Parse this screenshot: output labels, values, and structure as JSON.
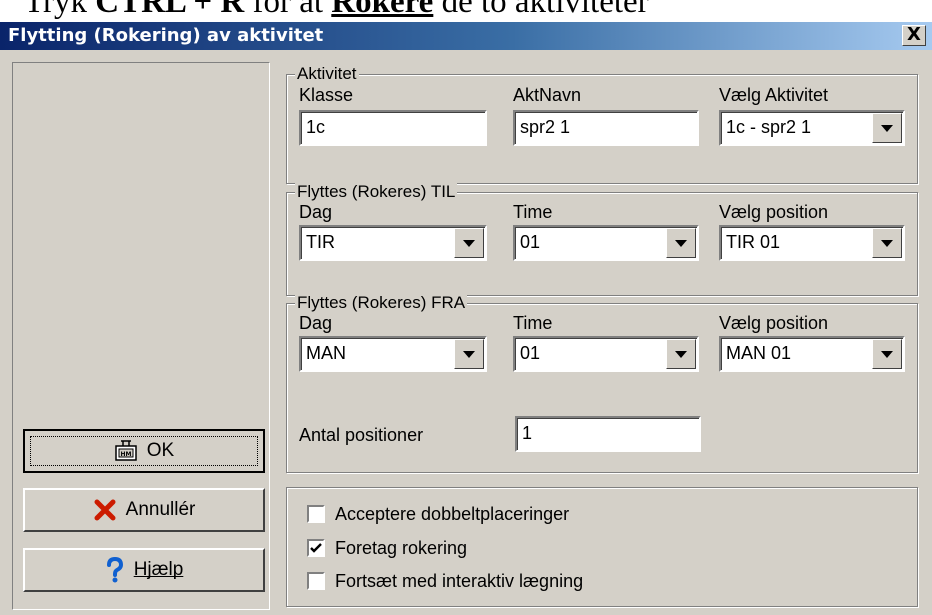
{
  "doc": {
    "prefix": "Tryk ",
    "shortcut": "CTRL + R",
    "middle": " for at ",
    "action": "Rokere",
    "suffix": " de to aktiviteter"
  },
  "window": {
    "title": "Flytting (Rokering) av aktivitet",
    "close_label": "X"
  },
  "buttons": {
    "ok": "OK",
    "cancel": "Annullér",
    "help": "Hjælp"
  },
  "aktivitet": {
    "legend": "Aktivitet",
    "klasse_label": "Klasse",
    "klasse_value": "1c",
    "aktnavn_label": "AktNavn",
    "aktnavn_value": "spr2 1",
    "vaelg_label": "Vælg Aktivitet",
    "vaelg_value": "1c - spr2 1"
  },
  "til": {
    "legend": "Flyttes (Rokeres) TIL",
    "dag_label": "Dag",
    "dag_value": "TIR",
    "time_label": "Time",
    "time_value": "01",
    "pos_label": "Vælg position",
    "pos_value": "TIR 01"
  },
  "fra": {
    "legend": "Flyttes (Rokeres) FRA",
    "dag_label": "Dag",
    "dag_value": "MAN",
    "time_label": "Time",
    "time_value": "01",
    "pos_label": "Vælg position",
    "pos_value": "MAN 01",
    "antal_label": "Antal positioner",
    "antal_value": "1"
  },
  "options": [
    {
      "label": "Acceptere dobbeltplaceringer",
      "checked": false
    },
    {
      "label": "Foretag rokering",
      "checked": true
    },
    {
      "label": "Fortsæt med interaktiv lægning",
      "checked": false
    }
  ]
}
